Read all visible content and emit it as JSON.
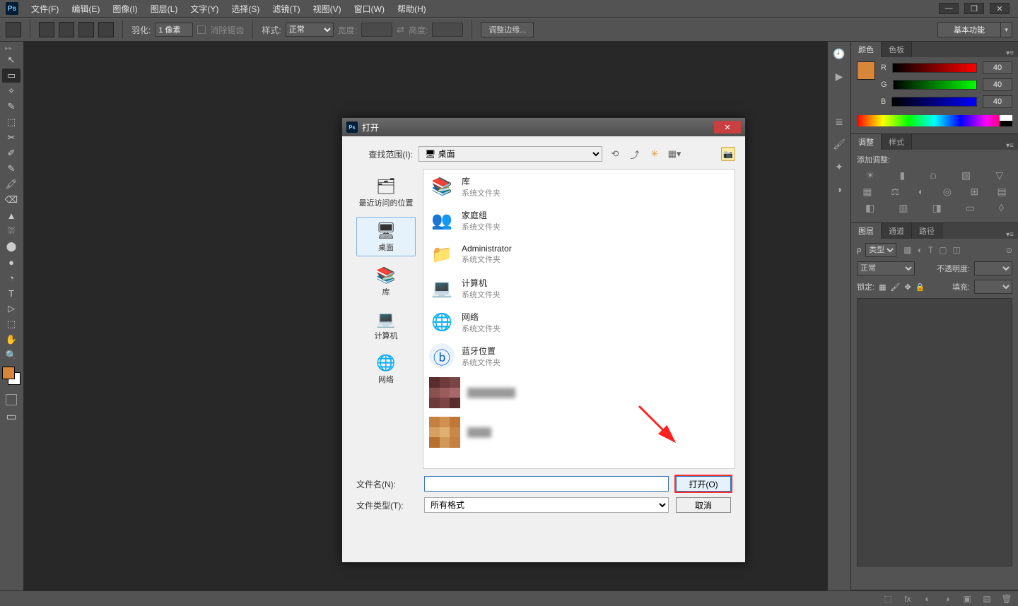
{
  "app": {
    "logo": "Ps"
  },
  "menubar": [
    "文件(F)",
    "编辑(E)",
    "图像(I)",
    "图层(L)",
    "文字(Y)",
    "选择(S)",
    "滤镜(T)",
    "视图(V)",
    "窗口(W)",
    "帮助(H)"
  ],
  "options": {
    "feather_label": "羽化:",
    "feather_value": "1 像素",
    "antialias": "消除锯齿",
    "style_label": "样式:",
    "style_value": "正常",
    "width_label": "宽度:",
    "height_label": "高度:",
    "refine_edge": "调整边缘...",
    "workspace": "基本功能"
  },
  "tools": [
    "↖",
    "▭",
    "✧",
    "✎",
    "⬚",
    "✂",
    "✐",
    "✎",
    "🖍",
    "⌫",
    "▲",
    "⛆",
    "⬤",
    "●",
    "◔",
    "✒",
    "T",
    "▷",
    "⬚",
    "✋",
    "🔍"
  ],
  "colors": {
    "fg": "#d8863a",
    "bg": "#ffffff"
  },
  "panels": {
    "color": {
      "tabs": [
        "颜色",
        "色板"
      ],
      "labels": [
        "R",
        "G",
        "B"
      ],
      "vals": [
        "40",
        "40",
        "40"
      ]
    },
    "adjust": {
      "tabs": [
        "调整",
        "样式"
      ],
      "title": "添加调整:"
    },
    "layers": {
      "tabs": [
        "图层",
        "通道",
        "路径"
      ],
      "filter_label": "类型",
      "blend": "正常",
      "opacity_label": "不透明度:",
      "lock_label": "锁定:",
      "fill_label": "填充:"
    }
  },
  "dialog": {
    "title": "打开",
    "look_in_label": "查找范围(I):",
    "look_in_value": "桌面",
    "places": [
      {
        "icon": "🗂",
        "label": "最近访问的位置"
      },
      {
        "icon": "🖥",
        "label": "桌面",
        "selected": true
      },
      {
        "icon": "📚",
        "label": "库"
      },
      {
        "icon": "💻",
        "label": "计算机"
      },
      {
        "icon": "🌐",
        "label": "网络"
      }
    ],
    "files": [
      {
        "icon": "📚",
        "name": "库",
        "type": "系统文件夹"
      },
      {
        "icon": "👥",
        "name": "家庭组",
        "type": "系统文件夹"
      },
      {
        "icon": "👤",
        "name": "Administrator",
        "type": "系统文件夹"
      },
      {
        "icon": "💻",
        "name": "计算机",
        "type": "系统文件夹"
      },
      {
        "icon": "🌐",
        "name": "网络",
        "type": "系统文件夹"
      },
      {
        "icon": "ⓑ",
        "name": "蓝牙位置",
        "type": "系统文件夹"
      }
    ],
    "filename_label": "文件名(N):",
    "filename_value": "",
    "filetype_label": "文件类型(T):",
    "filetype_value": "所有格式",
    "open_btn": "打开(O)",
    "cancel_btn": "取消"
  }
}
